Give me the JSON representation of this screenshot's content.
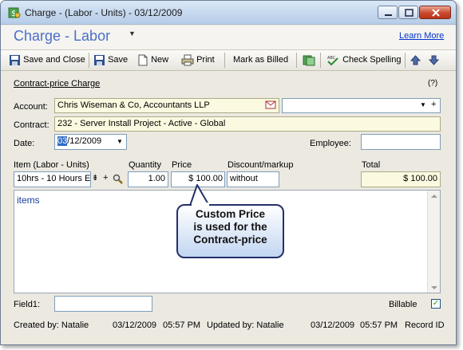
{
  "window": {
    "title": "Charge - (Labor - Units) - 03/12/2009"
  },
  "header": {
    "title": "Charge - Labor",
    "learn_more": "Learn More"
  },
  "toolbar": {
    "save_close": "Save and Close",
    "save": "Save",
    "new": "New",
    "print": "Print",
    "mark_billed": "Mark as Billed",
    "check_spelling": "Check Spelling"
  },
  "form": {
    "section": "Contract-price Charge",
    "help": "(?)",
    "account_label": "Account:",
    "account_value": "Chris Wiseman & Co, Accountants LLP",
    "contract_label": "Contract:",
    "contract_value": "232 - Server Install Project - Active -  Global",
    "date_label": "Date:",
    "date_month": "03",
    "date_rest": "/12/2009",
    "employee_label": "Employee:",
    "item_label": "Item  (Labor - Units)",
    "quantity_label": "Quantity",
    "price_label": "Price",
    "discount_label": "Discount/markup",
    "total_label": "Total",
    "item_value": "10hrs - 10 Hours E",
    "quantity_value": "1.00",
    "price_value": "$ 100.00",
    "discount_value": "without",
    "total_value": "$ 100.00",
    "items_text": "items",
    "field1_label": "Field1:",
    "billable_label": "Billable"
  },
  "callout": {
    "line1": "Custom Price",
    "line2": "is used for the",
    "line3": "Contract-price"
  },
  "footer": {
    "created_by": "Created by: Natalie",
    "created_date": "03/12/2009",
    "created_time": "05:57 PM",
    "updated_by": "Updated by: Natalie",
    "updated_date": "03/12/2009",
    "updated_time": "05:57 PM",
    "record_id": "Record ID"
  }
}
